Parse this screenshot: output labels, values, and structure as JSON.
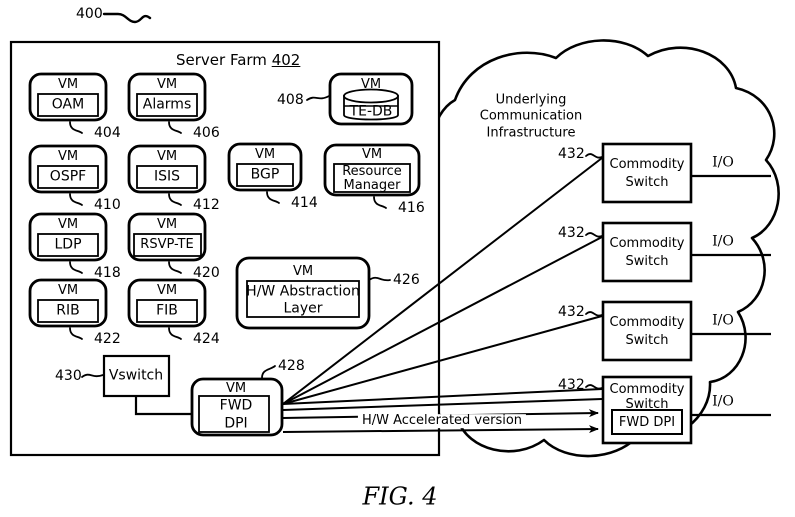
{
  "figure": {
    "caption": "FIG. 4",
    "top_ref": "400"
  },
  "server_farm": {
    "title_text": "Server Farm",
    "title_ref": "402",
    "vm_label": "VM",
    "vms": [
      {
        "name": "OAM",
        "ref": "404"
      },
      {
        "name": "Alarms",
        "ref": "406"
      },
      {
        "name": "TE-DB",
        "ref": "408"
      },
      {
        "name": "OSPF",
        "ref": "410"
      },
      {
        "name": "ISIS",
        "ref": "412"
      },
      {
        "name": "BGP",
        "ref": "414"
      },
      {
        "name": "Resource Manager",
        "ref": "416"
      },
      {
        "name": "LDP",
        "ref": "418"
      },
      {
        "name": "RSVP-TE",
        "ref": "420"
      },
      {
        "name": "RIB",
        "ref": "422"
      },
      {
        "name": "FIB",
        "ref": "424"
      },
      {
        "name": "H/W Abstraction Layer",
        "ref": "426"
      },
      {
        "name": "FWD DPI",
        "ref": "428"
      }
    ],
    "resource_manager_line1": "Resource",
    "resource_manager_line2": "Manager",
    "hw_abstraction_line1": "H/W Abstraction",
    "hw_abstraction_line2": "Layer",
    "fwd_line1": "FWD",
    "fwd_line2": "DPI",
    "vswitch": {
      "label": "Vswitch",
      "ref": "430"
    }
  },
  "cloud": {
    "label_line1": "Underlying",
    "label_line2": "Communication",
    "label_line3": "Infrastructure",
    "switch_label_line1": "Commodity",
    "switch_label_line2": "Switch",
    "io_label": "I/O",
    "switch_ref": "432",
    "switches": [
      {
        "ref": "432",
        "io": "I/O",
        "has_fwd_dpi": false
      },
      {
        "ref": "432",
        "io": "I/O",
        "has_fwd_dpi": false
      },
      {
        "ref": "432",
        "io": "I/O",
        "has_fwd_dpi": false
      },
      {
        "ref": "432",
        "io": "I/O",
        "has_fwd_dpi": true
      }
    ],
    "fwd_dpi_label": "FWD DPI"
  },
  "connections": {
    "accelerated_label": "H/W Accelerated version"
  },
  "colors": {
    "stroke": "#000000",
    "background": "#ffffff"
  }
}
